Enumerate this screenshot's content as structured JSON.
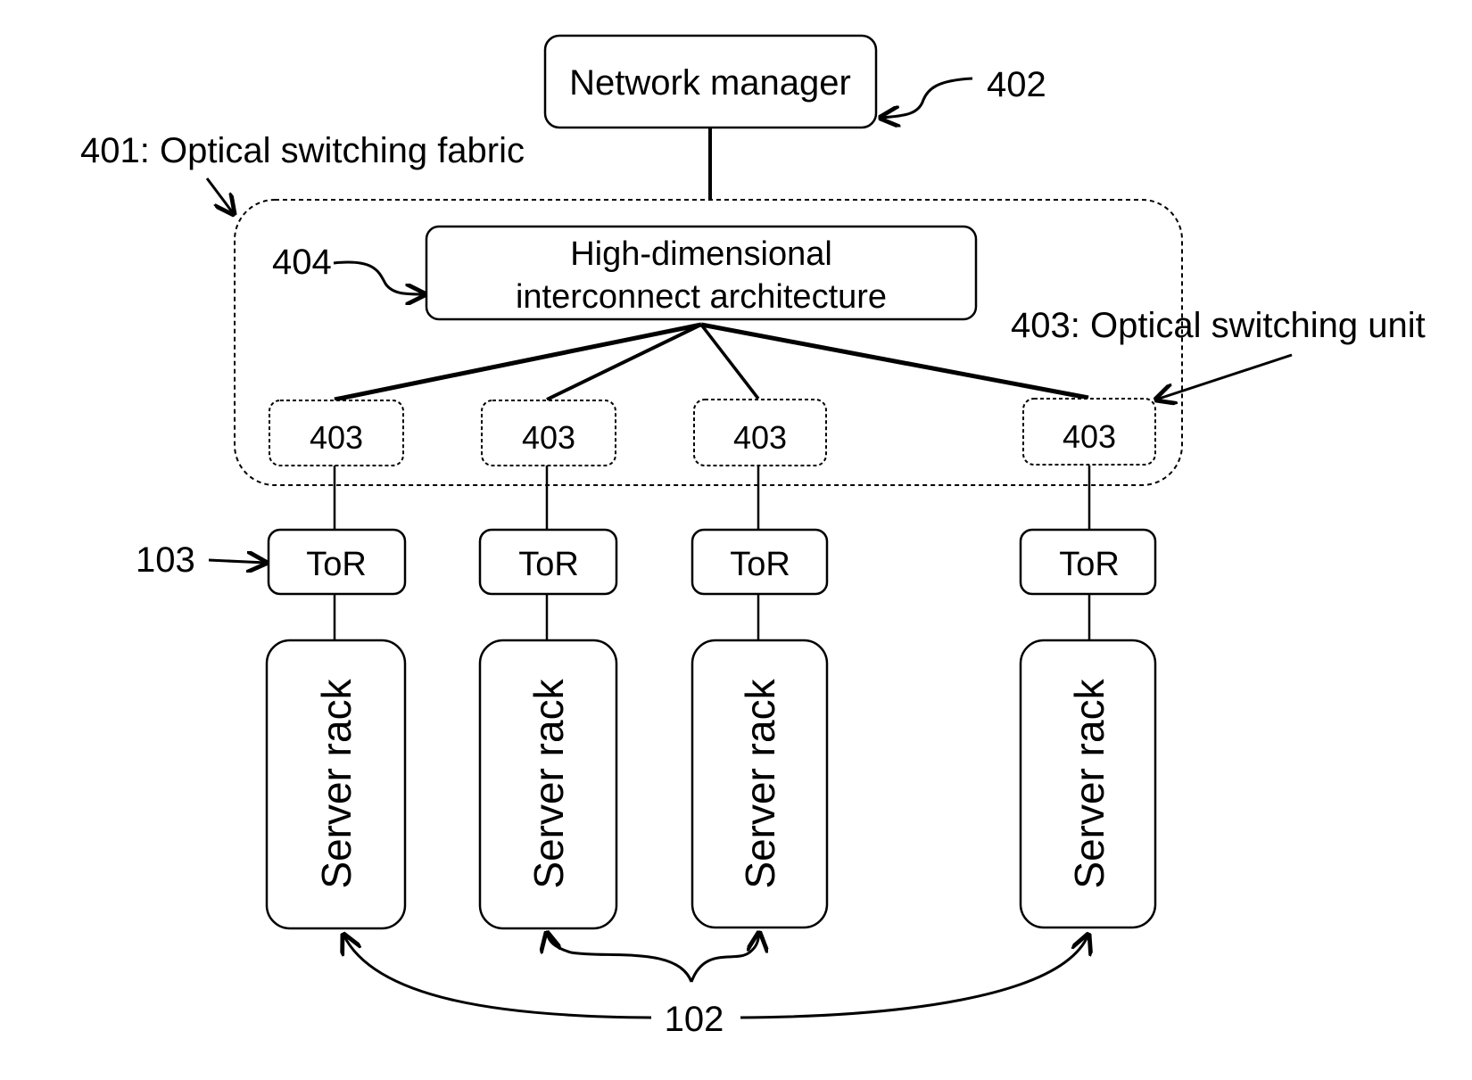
{
  "diagram": {
    "network_manager": {
      "label": "Network manager",
      "ref": "402"
    },
    "fabric": {
      "label": "401: Optical switching fabric"
    },
    "interconnect": {
      "line1": "High-dimensional",
      "line2": "interconnect architecture",
      "ref": "404"
    },
    "switch_unit_callout": "403: Optical switching unit",
    "columns": [
      {
        "switch": "403",
        "tor": "ToR",
        "rack": "Server rack"
      },
      {
        "switch": "403",
        "tor": "ToR",
        "rack": "Server rack"
      },
      {
        "switch": "403",
        "tor": "ToR",
        "rack": "Server rack"
      },
      {
        "switch": "403",
        "tor": "ToR",
        "rack": "Server rack"
      }
    ],
    "tor_ref": "103",
    "rack_ref": "102"
  }
}
